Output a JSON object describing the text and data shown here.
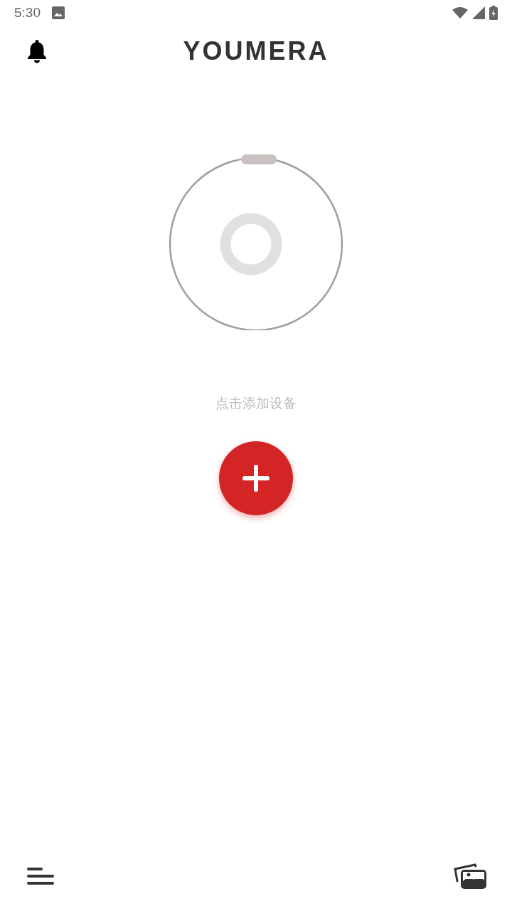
{
  "status_bar": {
    "time": "5:30"
  },
  "header": {
    "logo": "YOUMERA"
  },
  "device": {
    "hint": "点击添加设备"
  }
}
